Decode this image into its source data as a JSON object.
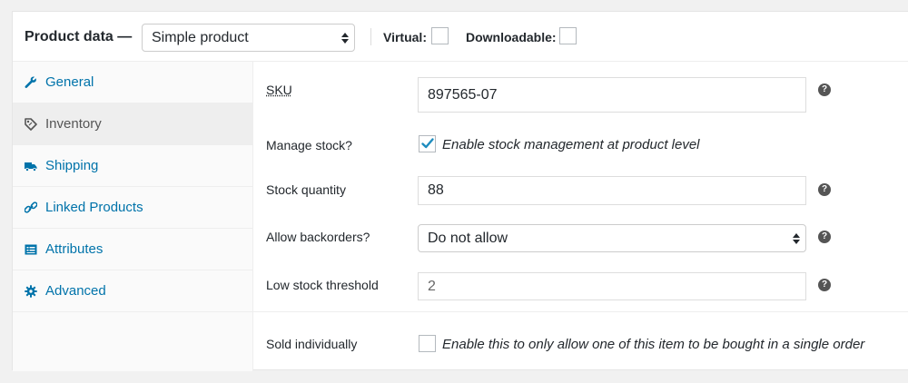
{
  "header": {
    "title": "Product data —",
    "product_type": "Simple product",
    "virtual_label": "Virtual:",
    "downloadable_label": "Downloadable:"
  },
  "tabs": [
    {
      "label": "General",
      "icon": "wrench-icon"
    },
    {
      "label": "Inventory",
      "icon": "tag-icon",
      "active": true
    },
    {
      "label": "Shipping",
      "icon": "truck-icon"
    },
    {
      "label": "Linked Products",
      "icon": "link-icon"
    },
    {
      "label": "Attributes",
      "icon": "list-icon"
    },
    {
      "label": "Advanced",
      "icon": "gear-icon"
    }
  ],
  "inventory": {
    "sku_label": "SKU",
    "sku_value": "897565-07",
    "manage_stock_label": "Manage stock?",
    "manage_stock_desc": "Enable stock management at product level",
    "stock_qty_label": "Stock quantity",
    "stock_qty_value": "88",
    "backorders_label": "Allow backorders?",
    "backorders_value": "Do not allow",
    "low_stock_label": "Low stock threshold",
    "low_stock_value": "2",
    "sold_individually_label": "Sold individually",
    "sold_individually_desc": "Enable this to only allow one of this item to be bought in a single order",
    "help_glyph": "?"
  },
  "colors": {
    "link": "#0073aa",
    "active_tab_bg": "#eeeeee",
    "check": "#1e8cbe"
  }
}
